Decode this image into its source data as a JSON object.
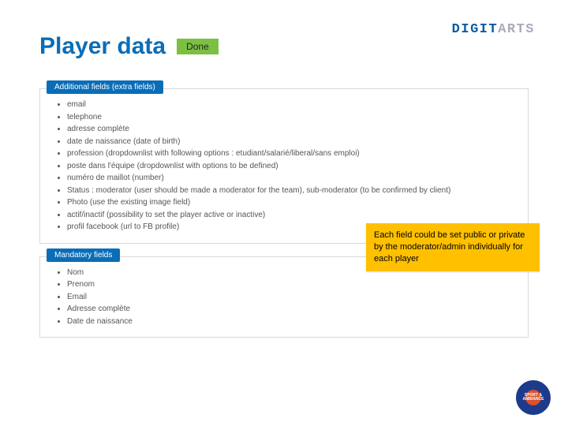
{
  "brand": {
    "left": "DIGIT",
    "right": "ARTS"
  },
  "title": "Player data",
  "status": "Done",
  "panels": [
    {
      "header": "Additional fields (extra fields)",
      "items": [
        "email",
        "telephone",
        "adresse complète",
        "date de naissance (date of birth)",
        "profession (dropdownlist with following options : etudiant/salarié/liberal/sans emploi)",
        "poste dans l'équipe (dropdownlist with options to be defined)",
        "numéro de maillot (number)",
        "Status : moderator (user should be made a moderator for the team), sub-moderator (to be confirmed by client)",
        "Photo (use the existing image field)",
        "actif/inactif (possibility to set the player active or inactive)",
        "profil facebook (url to FB profile)"
      ]
    },
    {
      "header": "Mandatory fields",
      "items": [
        "Nom",
        "Prenom",
        "Email",
        "Adresse complète",
        "Date de naissance"
      ]
    }
  ],
  "callout": "Each field could be set public or private by the moderator/admin individually for each player",
  "badge": "SPORT & AMBIANCE"
}
